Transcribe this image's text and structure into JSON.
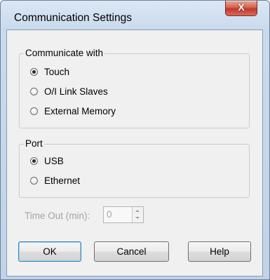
{
  "window": {
    "title": "Communication Settings",
    "close_label": "X"
  },
  "communicate_with": {
    "legend": "Communicate with",
    "options": [
      {
        "label": "Touch",
        "checked": true
      },
      {
        "label": "O/I Link Slaves",
        "checked": false
      },
      {
        "label": "External Memory",
        "checked": false
      }
    ]
  },
  "port": {
    "legend": "Port",
    "options": [
      {
        "label": "USB",
        "checked": true
      },
      {
        "label": "Ethernet",
        "checked": false
      }
    ]
  },
  "timeout": {
    "label": "Time Out (min):",
    "value": "0",
    "enabled": false
  },
  "buttons": {
    "ok": "OK",
    "cancel": "Cancel",
    "help": "Help"
  },
  "colors": {
    "close_button": "#c0392b",
    "disabled_text": "#a4a4a4",
    "default_button_border": "#3c7fb1"
  }
}
